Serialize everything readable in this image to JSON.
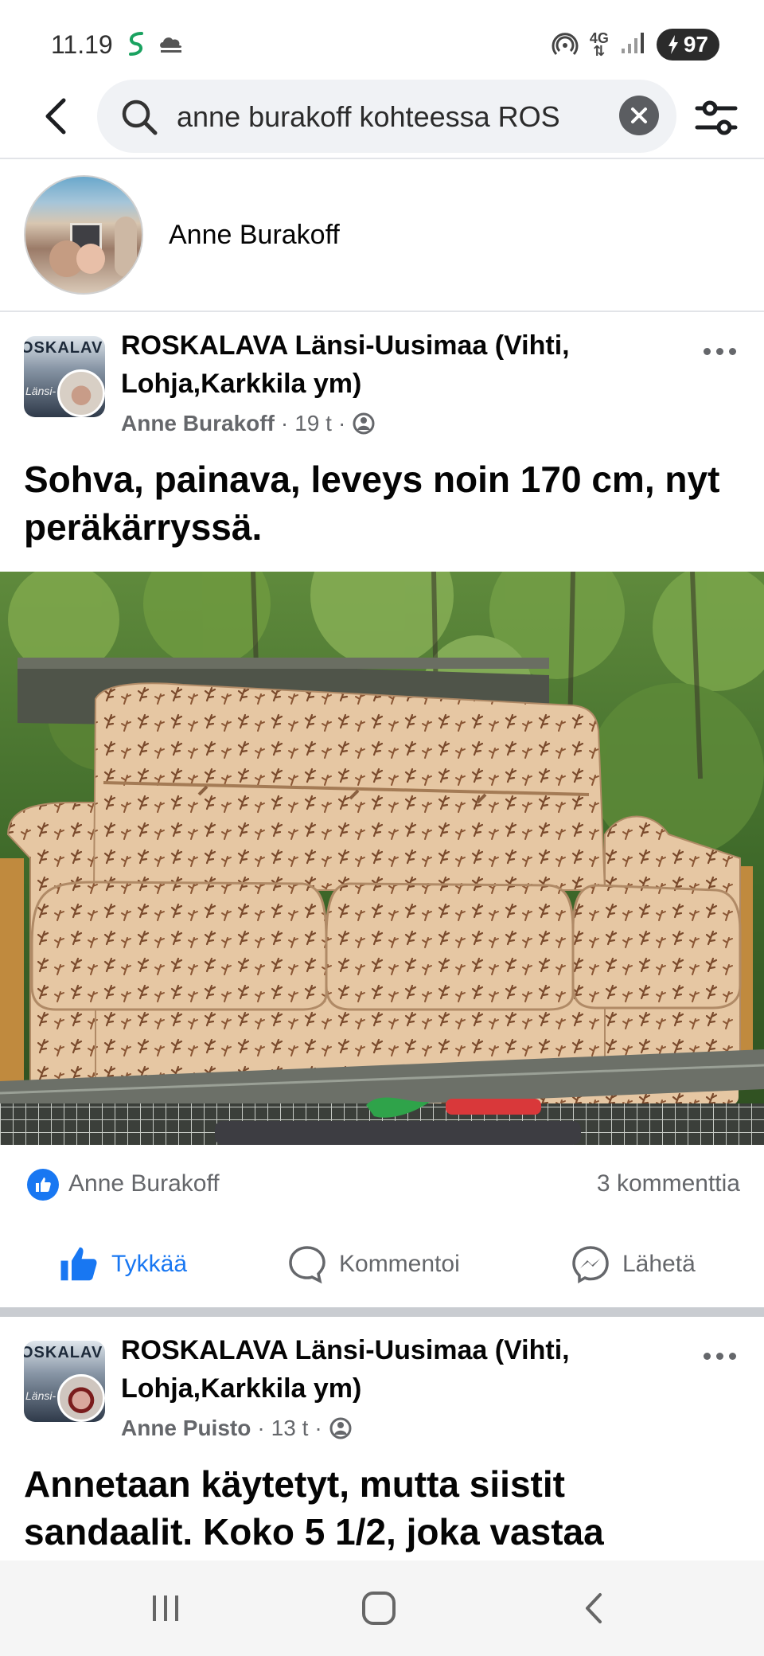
{
  "status_bar": {
    "time": "11.19",
    "network": "4G",
    "battery": "97"
  },
  "search": {
    "query": "anne burakoff kohteessa ROS"
  },
  "profile": {
    "name": "Anne Burakoff"
  },
  "posts": [
    {
      "group": "ROSKALAVA Länsi-Uusimaa (Vihti, Lohja,Karkkila ym)",
      "group_avatar_title": "OSKALAV",
      "group_avatar_sub": "Länsi-",
      "author": "Anne Burakoff",
      "time": "19 t",
      "text": "Sohva, painava, leveys noin 170 cm, nyt peräkärryssä.",
      "reaction_name": "Anne Burakoff",
      "comments": "3 kommenttia"
    },
    {
      "group": "ROSKALAVA Länsi-Uusimaa (Vihti, Lohja,Karkkila ym)",
      "group_avatar_title": "OSKALAV",
      "group_avatar_sub": "Länsi-",
      "author": "Anne Puisto",
      "time": "13 t",
      "text": "Annetaan käytetyt, mutta siistit sandaalit. Koko 5 1/2, joka vastaa"
    }
  ],
  "actions": {
    "like": "Tykkää",
    "comment": "Kommentoi",
    "share": "Lähetä"
  },
  "icons": {
    "status_left": [
      "swype-icon",
      "cloud-icon"
    ],
    "status_right": [
      "hotspot-icon",
      "network-icon",
      "signal-icon",
      "battery-icon"
    ],
    "header": [
      "back-icon",
      "search-icon",
      "clear-icon",
      "filter-icon"
    ],
    "nav": [
      "recent-apps-icon",
      "home-icon",
      "back-nav-icon"
    ]
  },
  "colors": {
    "accent": "#1877f2",
    "muted_text": "#65676b",
    "search_bg": "#f0f2f5",
    "separator": "#c9ccd1"
  }
}
